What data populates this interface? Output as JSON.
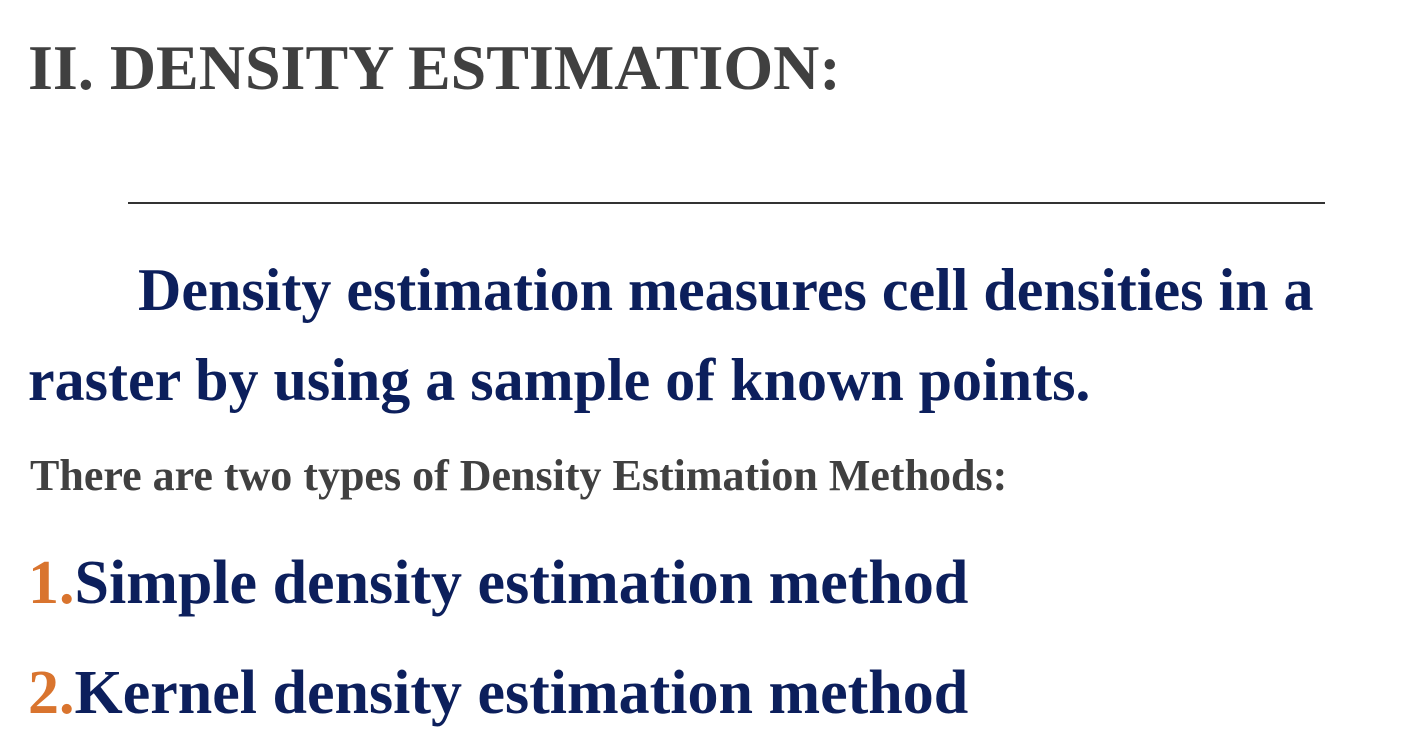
{
  "heading": "II. DENSITY ESTIMATION:",
  "lead": "Density estimation measures cell densities in a raster by using a sample of known points.",
  "subheading": "There are two types of Density Estimation Methods:",
  "methods": [
    {
      "number": "1.",
      "label": "Simple density estimation method"
    },
    {
      "number": "2.",
      "label": "Kernel density estimation method"
    }
  ],
  "colors": {
    "heading": "#404040",
    "lead": "#0c1f5c",
    "number": "#d9742e"
  }
}
